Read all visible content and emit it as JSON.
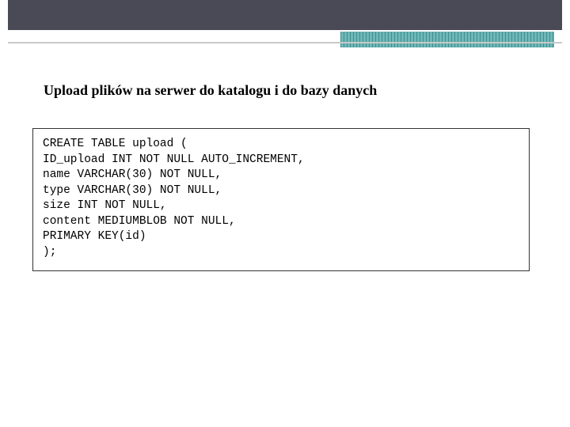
{
  "heading": "Upload plików na serwer do katalogu i do bazy danych",
  "code": "CREATE TABLE upload (\nID_upload INT NOT NULL AUTO_INCREMENT,\nname VARCHAR(30) NOT NULL,\ntype VARCHAR(30) NOT NULL,\nsize INT NOT NULL,\ncontent MEDIUMBLOB NOT NULL,\nPRIMARY KEY(id)\n);"
}
